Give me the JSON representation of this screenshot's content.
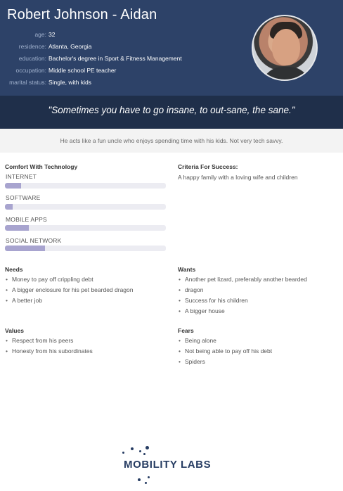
{
  "persona": {
    "name": "Robert Johnson - Aidan",
    "facts": [
      {
        "label": "age:",
        "value": "32"
      },
      {
        "label": "residence:",
        "value": "Atlanta, Georgia"
      },
      {
        "label": "education:",
        "value": "Bachelor's degree in Sport & Fitness Management"
      },
      {
        "label": "occupation:",
        "value": "Middle school PE teacher"
      },
      {
        "label": "marital status:",
        "value": "Single, with kids"
      }
    ],
    "quote": "\"Sometimes you have to go insane, to out-sane, the sane.\"",
    "summary": "He acts like a fun uncle who enjoys spending time with his kids. Not very tech savvy."
  },
  "comfort": {
    "title": "Comfort With Technology",
    "items": [
      {
        "label": "INTERNET",
        "level": 0.1
      },
      {
        "label": "SOFTWARE",
        "level": 0.05
      },
      {
        "label": "MOBILE APPS",
        "level": 0.15
      },
      {
        "label": "SOCIAL NETWORK",
        "level": 0.25
      }
    ]
  },
  "criteria": {
    "title": "Criteria For Success:",
    "text": "A happy family with a loving wife and children"
  },
  "needs": {
    "title": "Needs",
    "items": [
      "Money to pay off crippling debt",
      "A bigger enclosure for his pet bearded dragon",
      "A better job"
    ]
  },
  "wants": {
    "title": "Wants",
    "items": [
      "Another pet lizard, preferably another bearded",
      "dragon",
      "Success for his children",
      "A bigger house"
    ]
  },
  "values": {
    "title": "Values",
    "items": [
      "Respect from his peers",
      "Honesty from his subordinates"
    ]
  },
  "fears": {
    "title": "Fears",
    "items": [
      "Being alone",
      "Not being able to pay off his debt",
      "Spiders"
    ]
  },
  "logo": {
    "text": "MOBILITY LABS"
  },
  "colors": {
    "header": "#2d4268",
    "quote_band": "#1f2f4a",
    "bar_fill": "#a8a4cf",
    "bar_track": "#ececf2"
  }
}
